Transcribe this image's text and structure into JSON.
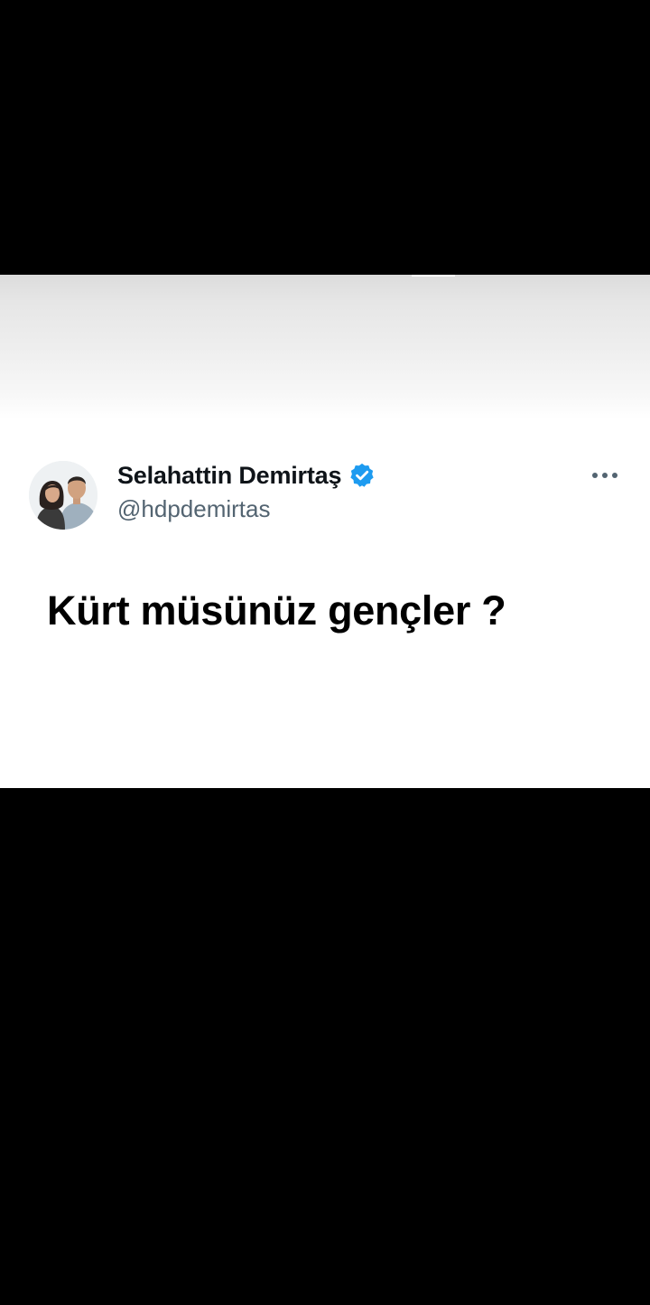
{
  "tweet": {
    "display_name": "Selahattin Demirtaş",
    "handle": "@hdpdemirtas",
    "text": "Kürt müsünüz gençler ?",
    "verified": true
  },
  "icons": {
    "verified": "verified-badge-icon",
    "more": "more-options-icon",
    "avatar": "profile-photo"
  },
  "colors": {
    "verified_badge": "#1d9bf0",
    "name_text": "#0f1419",
    "handle_text": "#536471",
    "background": "#ffffff",
    "letterbox": "#000000"
  }
}
